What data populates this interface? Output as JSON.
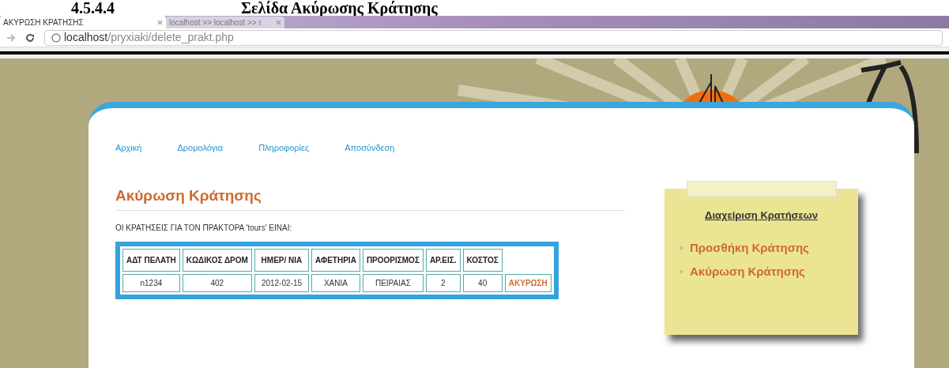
{
  "document_heading": {
    "number": "4.5.4.4",
    "title": "Σελίδα Ακύρωσης Κράτησης"
  },
  "browser": {
    "tabs": [
      {
        "label": "ΑΚΥΡΩΣΗ ΚΡΑΤΗΣΗΣ",
        "selected": true
      },
      {
        "label": "localhost >> localhost >> r",
        "selected": false
      }
    ],
    "address": {
      "host": "localhost",
      "path": "/pryxiaki/delete_prakt.php"
    }
  },
  "nav": [
    "Αρχική",
    "Δρομολόγια",
    "Πληροφορίες",
    "Αποσύνδεση"
  ],
  "page_title": "Ακύρωση Κράτησης",
  "intro": "ΟΙ ΚΡΑΤΗΣΕΙΣ ΓΙΑ ΤΟΝ ΠΡΑΚΤΟΡΑ 'tours' ΕΙΝΑΙ:",
  "table": {
    "columns": [
      "ΑΔΤ ΠΕΛΑΤΗ",
      "ΚΩΔΙΚΟΣ ΔΡΟΜ",
      "ΗΜΕΡ/ ΝΙΑ",
      "ΑΦΕΤΗΡΙΑ",
      "ΠΡΟΟΡΙΣΜΟΣ",
      "ΑΡ.ΕΙΣ.",
      "ΚΟΣΤΟΣ",
      null
    ],
    "rows": [
      {
        "cells": [
          "n1234",
          "402",
          "2012-02-15",
          "ΧΑΝΙΑ",
          "ΠΕΙΡΑΙΑΣ",
          "2",
          "40"
        ],
        "action": "ΑΚΥΡΩΣΗ"
      }
    ]
  },
  "sidebar": {
    "title": "Διαχείριση Κρατήσεων",
    "items": [
      "Προσθήκη Κράτησης",
      "Ακύρωση Κράτησης"
    ]
  }
}
